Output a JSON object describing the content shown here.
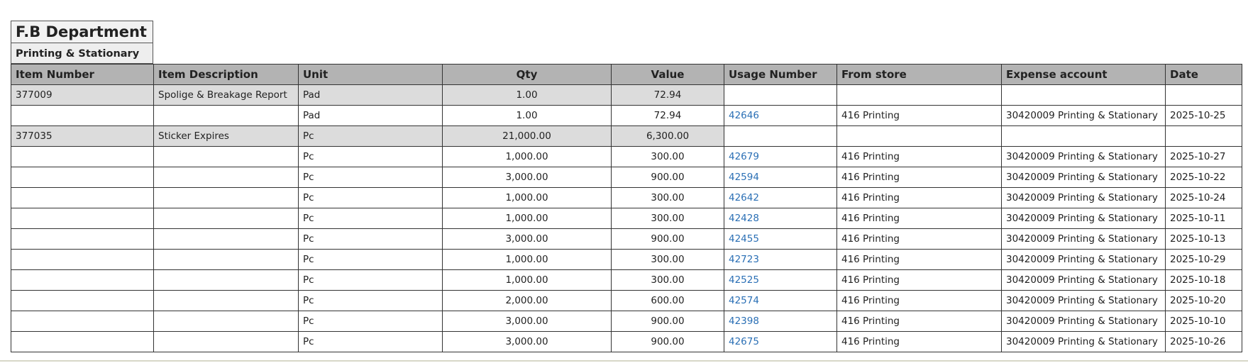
{
  "department": "F.B Department",
  "category": "Printing & Stationary",
  "columns": [
    "Item Number",
    "Item Description",
    "Unit",
    "Qty",
    "Value",
    "Usage Number",
    "From store",
    "Expense account",
    "Date"
  ],
  "rows": [
    {
      "type": "group",
      "item_number": "377009",
      "description": "Spolige & Breakage Report",
      "unit": "Pad",
      "qty": "1.00",
      "value": "72.94",
      "usage": "",
      "store": "",
      "account": "",
      "date": ""
    },
    {
      "type": "detail",
      "item_number": "",
      "description": "",
      "unit": "Pad",
      "qty": "1.00",
      "value": "72.94",
      "usage": "42646",
      "store": "416 Printing",
      "account": "30420009 Printing & Stationary",
      "date": "2025-10-25"
    },
    {
      "type": "group",
      "item_number": "377035",
      "description": "Sticker Expires",
      "unit": "Pc",
      "qty": "21,000.00",
      "value": "6,300.00",
      "usage": "",
      "store": "",
      "account": "",
      "date": ""
    },
    {
      "type": "detail",
      "item_number": "",
      "description": "",
      "unit": "Pc",
      "qty": "1,000.00",
      "value": "300.00",
      "usage": "42679",
      "store": "416 Printing",
      "account": "30420009 Printing & Stationary",
      "date": "2025-10-27"
    },
    {
      "type": "detail",
      "item_number": "",
      "description": "",
      "unit": "Pc",
      "qty": "3,000.00",
      "value": "900.00",
      "usage": "42594",
      "store": "416 Printing",
      "account": "30420009 Printing & Stationary",
      "date": "2025-10-22"
    },
    {
      "type": "detail",
      "item_number": "",
      "description": "",
      "unit": "Pc",
      "qty": "1,000.00",
      "value": "300.00",
      "usage": "42642",
      "store": "416 Printing",
      "account": "30420009 Printing & Stationary",
      "date": "2025-10-24"
    },
    {
      "type": "detail",
      "item_number": "",
      "description": "",
      "unit": "Pc",
      "qty": "1,000.00",
      "value": "300.00",
      "usage": "42428",
      "store": "416 Printing",
      "account": "30420009 Printing & Stationary",
      "date": "2025-10-11"
    },
    {
      "type": "detail",
      "item_number": "",
      "description": "",
      "unit": "Pc",
      "qty": "3,000.00",
      "value": "900.00",
      "usage": "42455",
      "store": "416 Printing",
      "account": "30420009 Printing & Stationary",
      "date": "2025-10-13"
    },
    {
      "type": "detail",
      "item_number": "",
      "description": "",
      "unit": "Pc",
      "qty": "1,000.00",
      "value": "300.00",
      "usage": "42723",
      "store": "416 Printing",
      "account": "30420009 Printing & Stationary",
      "date": "2025-10-29"
    },
    {
      "type": "detail",
      "item_number": "",
      "description": "",
      "unit": "Pc",
      "qty": "1,000.00",
      "value": "300.00",
      "usage": "42525",
      "store": "416 Printing",
      "account": "30420009 Printing & Stationary",
      "date": "2025-10-18"
    },
    {
      "type": "detail",
      "item_number": "",
      "description": "",
      "unit": "Pc",
      "qty": "2,000.00",
      "value": "600.00",
      "usage": "42574",
      "store": "416 Printing",
      "account": "30420009 Printing & Stationary",
      "date": "2025-10-20"
    },
    {
      "type": "detail",
      "item_number": "",
      "description": "",
      "unit": "Pc",
      "qty": "3,000.00",
      "value": "900.00",
      "usage": "42398",
      "store": "416 Printing",
      "account": "30420009 Printing & Stationary",
      "date": "2025-10-10"
    },
    {
      "type": "detail",
      "item_number": "",
      "description": "",
      "unit": "Pc",
      "qty": "3,000.00",
      "value": "900.00",
      "usage": "42675",
      "store": "416 Printing",
      "account": "30420009 Printing & Stationary",
      "date": "2025-10-26"
    }
  ],
  "colors": {
    "header_bg": "#b3b3b3",
    "group_bg": "#dcdcdc",
    "link": "#2a6fb5"
  }
}
